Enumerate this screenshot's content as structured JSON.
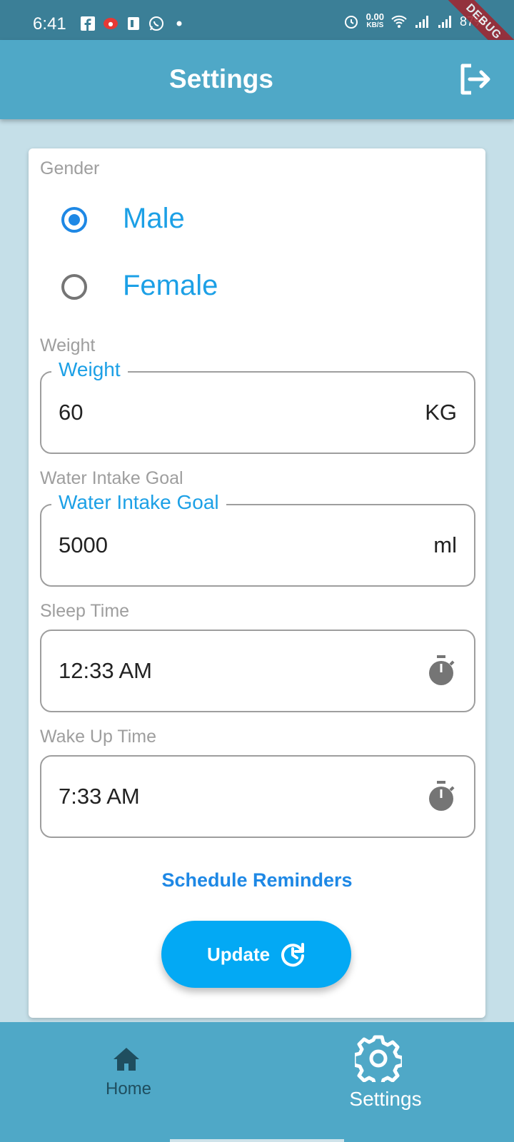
{
  "status_bar": {
    "time": "6:41",
    "left_icons": [
      "facebook-icon",
      "app-icon",
      "sim-toolkit-icon",
      "whatsapp-icon",
      "dot-icon"
    ],
    "net_speed_value": "0.00",
    "net_speed_unit": "KB/S",
    "battery": "87%",
    "right_icons": [
      "alarm-icon",
      "wifi-icon",
      "signal-icon",
      "signal-icon",
      "battery-icon"
    ]
  },
  "debug_banner": "DEBUG",
  "app_bar": {
    "title": "Settings",
    "action_icon": "logout-icon"
  },
  "form": {
    "gender": {
      "label": "Gender",
      "options": [
        {
          "label": "Male",
          "selected": true
        },
        {
          "label": "Female",
          "selected": false
        }
      ]
    },
    "weight": {
      "section_label": "Weight",
      "field_label": "Weight",
      "value": "60",
      "suffix": "KG"
    },
    "water_goal": {
      "section_label": "Water Intake Goal",
      "field_label": "Water Intake Goal",
      "value": "5000",
      "suffix": "ml"
    },
    "sleep_time": {
      "section_label": "Sleep Time",
      "value": "12:33 AM",
      "icon": "timer-icon"
    },
    "wake_time": {
      "section_label": "Wake Up Time",
      "value": "7:33 AM",
      "icon": "timer-icon"
    },
    "schedule_link": "Schedule Reminders",
    "update_button": {
      "label": "Update",
      "icon": "update-icon"
    }
  },
  "bottom_nav": {
    "items": [
      {
        "label": "Home",
        "icon": "home-icon",
        "active": false
      },
      {
        "label": "Settings",
        "icon": "gear-icon",
        "active": true
      }
    ]
  },
  "colors": {
    "app_bar": "#4fa8c7",
    "status_bar": "#3b7f97",
    "background": "#c5dfe8",
    "accent": "#1ca0e6",
    "radio_active": "#1e88e5",
    "button": "#03a9f4"
  }
}
